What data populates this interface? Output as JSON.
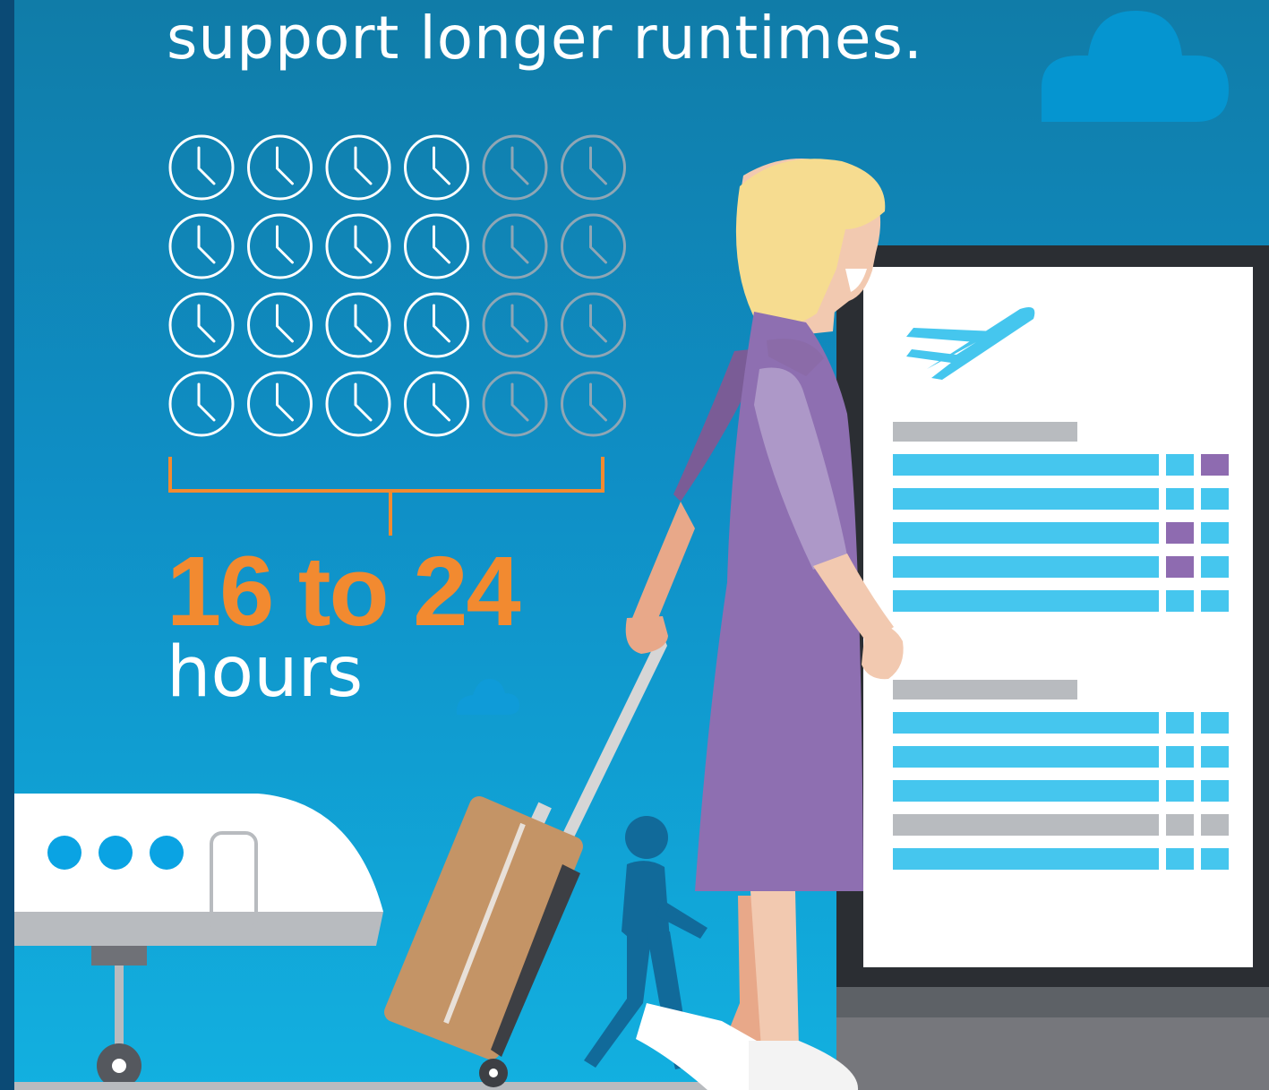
{
  "headline": "support longer runtimes.",
  "stat": {
    "value": "16 to 24",
    "unit": "hours"
  },
  "clock_grid": {
    "rows": 4,
    "columns": 6,
    "highlighted_columns": 4,
    "highlight_color": "#ffffff",
    "dim_color": "#8fa6b5"
  },
  "colors": {
    "accent": "#f28a30",
    "background_top": "#107ca8",
    "background_bottom": "#12b0e0",
    "board_row": "#45c6ee",
    "board_header": "#b8bbbf",
    "board_status_purple": "#8e6bb0"
  },
  "icons": {
    "board_icon": "airplane-departure-icon"
  }
}
